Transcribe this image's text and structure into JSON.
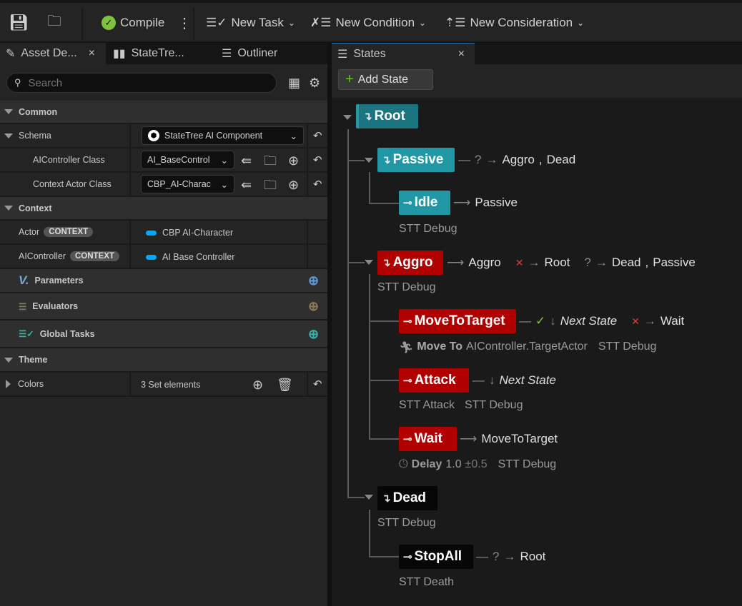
{
  "toolbar": {
    "compile": "Compile",
    "new_task": "New Task",
    "new_condition": "New Condition",
    "new_consideration": "New Consideration"
  },
  "tabs": {
    "asset_details": "Asset De...",
    "statetree": "StateTre...",
    "outliner": "Outliner",
    "states": "States"
  },
  "search": {
    "placeholder": "Search"
  },
  "details": {
    "common": "Common",
    "schema": "Schema",
    "schema_value": "StateTree AI Component",
    "aicontroller_class": "AIController Class",
    "aicontroller_value": "AI_BaseControl",
    "context_actor_class": "Context Actor Class",
    "context_actor_value": "CBP_AI-Charac",
    "context": "Context",
    "actor": "Actor",
    "context_badge": "CONTEXT",
    "actor_value": "CBP AI-Character",
    "aicontroller": "AIController",
    "aicontroller_ctx_value": "AI Base Controller",
    "parameters": "Parameters",
    "evaluators": "Evaluators",
    "global_tasks": "Global Tasks",
    "theme": "Theme",
    "colors": "Colors",
    "colors_value": "3 Set elements"
  },
  "states_panel": {
    "add_state": "Add State"
  },
  "tree": {
    "root": "Root",
    "passive": "Passive",
    "passive_t1": "Aggro",
    "passive_t2": "Dead",
    "idle": "Idle",
    "idle_t": "Passive",
    "idle_task": "STT Debug",
    "aggro": "Aggro",
    "aggro_t1": "Aggro",
    "aggro_t2": "Root",
    "aggro_t3": "Dead",
    "aggro_t4": "Passive",
    "aggro_task": "STT Debug",
    "move": "MoveToTarget",
    "move_t1": "Next State",
    "move_t2": "Wait",
    "move_task_label": "Move To",
    "move_task_target": "AIController.TargetActor",
    "move_task2": "STT Debug",
    "attack": "Attack",
    "attack_t": "Next State",
    "attack_task1": "STT Attack",
    "attack_task2": "STT Debug",
    "wait": "Wait",
    "wait_t": "MoveToTarget",
    "wait_delay_label": "Delay",
    "wait_delay": "1.0",
    "wait_dev": "±0.5",
    "wait_task2": "STT Debug",
    "dead": "Dead",
    "dead_task": "STT Debug",
    "stopall": "StopAll",
    "stopall_t": "Root",
    "stopall_task": "STT Death"
  },
  "colors": {
    "teal": "#2197a6",
    "red": "#b00000",
    "black": "#060606",
    "accent": "#00a8ff"
  }
}
